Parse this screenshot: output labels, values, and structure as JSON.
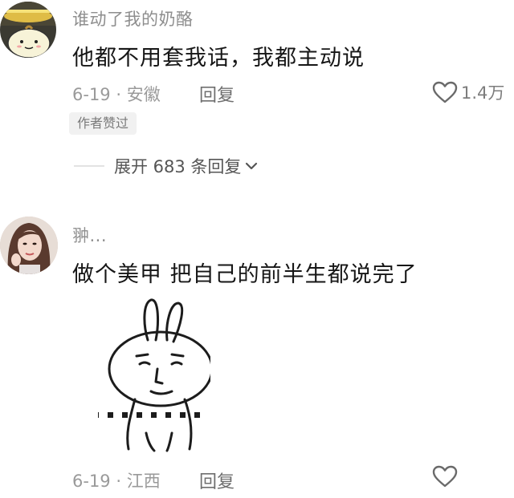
{
  "comments": [
    {
      "username": "谁动了我的奶酪",
      "text": "他都不用套我话，我都主动说",
      "date": "6-19",
      "location": "安徽",
      "reply_label": "回复",
      "likes": "1.4万",
      "badge": "作者赞过",
      "expand_label": "展开 683 条回复",
      "avatar_icon": "yellow-cartoon-face-avatar"
    },
    {
      "username": "翀...",
      "text": "做个美甲 把自己的前半生都说完了",
      "date": "6-19",
      "location": "江西",
      "reply_label": "回复",
      "avatar_icon": "woman-portrait-avatar",
      "sticker_icon": "bunny-meme-sticker"
    }
  ],
  "icons": {
    "like": "heart-outline-icon",
    "expand": "chevron-down-icon"
  },
  "colors": {
    "username": "#8e8e8e",
    "text": "#161616",
    "meta": "#9a9a9a",
    "badge_bg": "#f1f1f1"
  }
}
